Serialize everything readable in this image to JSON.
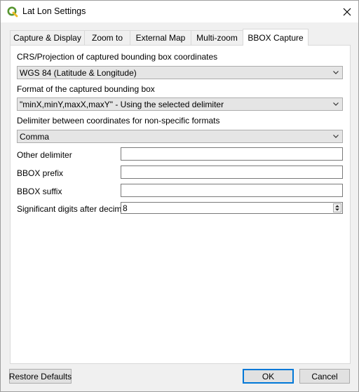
{
  "window": {
    "title": "Lat Lon Settings",
    "icons": {
      "app": "qgis-icon",
      "close": "close-icon"
    }
  },
  "tabs": [
    {
      "label": "Capture & Display",
      "active": false
    },
    {
      "label": "Zoom to",
      "active": false
    },
    {
      "label": "External Map",
      "active": false
    },
    {
      "label": "Multi-zoom",
      "active": false
    },
    {
      "label": "BBOX Capture",
      "active": true
    }
  ],
  "bbox": {
    "crs_label": "CRS/Projection of captured bounding box coordinates",
    "crs_value": "WGS 84 (Latitude & Longitude)",
    "format_label": "Format of the captured bounding box",
    "format_value": "\"minX,minY,maxX,maxY\" - Using the selected delimiter",
    "delimiter_label": "Delimiter between coordinates for non-specific formats",
    "delimiter_value": "Comma",
    "other_delimiter_label": "Other delimiter",
    "other_delimiter_value": "",
    "prefix_label": "BBOX prefix",
    "prefix_value": "",
    "suffix_label": "BBOX suffix",
    "suffix_value": "",
    "digits_label": "Significant digits after decimal",
    "digits_value": "8"
  },
  "buttons": {
    "restore": "Restore Defaults",
    "ok": "OK",
    "cancel": "Cancel"
  },
  "colors": {
    "accent": "#0078d7",
    "qgis_green": "#589632",
    "qgis_yellow": "#ee7913"
  }
}
